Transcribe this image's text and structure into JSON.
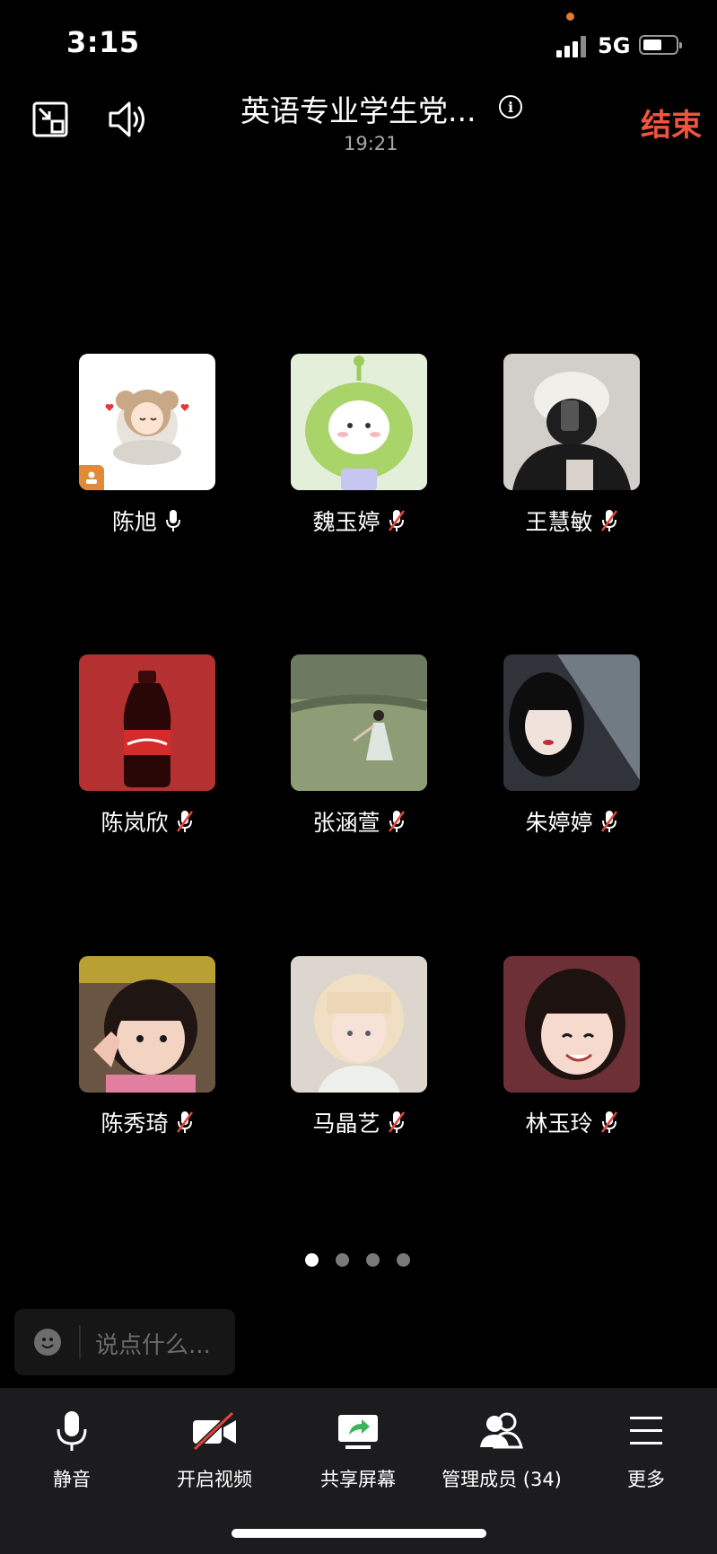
{
  "status_bar": {
    "time": "3:15",
    "network": "5G",
    "battery_percent": 60
  },
  "header": {
    "title": "英语专业学生党...",
    "elapsed": "19:21",
    "end_label": "结束"
  },
  "participants": [
    {
      "name": "陈旭",
      "mic": "on",
      "host": true
    },
    {
      "name": "魏玉婷",
      "mic": "muted"
    },
    {
      "name": "王慧敏",
      "mic": "muted"
    },
    {
      "name": "陈岚欣",
      "mic": "muted"
    },
    {
      "name": "张涵萱",
      "mic": "muted"
    },
    {
      "name": "朱婷婷",
      "mic": "muted"
    },
    {
      "name": "陈秀琦",
      "mic": "muted"
    },
    {
      "name": "马晶艺",
      "mic": "muted"
    },
    {
      "name": "林玉玲",
      "mic": "muted"
    }
  ],
  "pager": {
    "total": 4,
    "current": 1
  },
  "chat": {
    "placeholder": "说点什么..."
  },
  "toolbar": {
    "mute": "静音",
    "video": "开启视频",
    "share": "共享屏幕",
    "members": "管理成员 (34)",
    "more": "更多"
  },
  "colors": {
    "end": "#f0553f",
    "muted_slash": "#e0433a",
    "host_badge": "#e08a3a"
  }
}
